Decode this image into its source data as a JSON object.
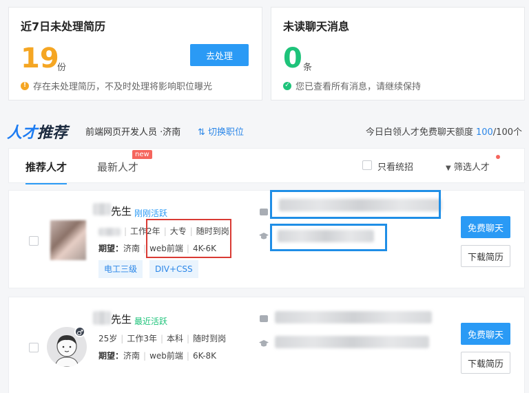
{
  "stats": {
    "pending": {
      "title": "近7日未处理简历",
      "count": "19",
      "unit": "份",
      "action": "去处理",
      "note": "存在未处理简历，不及时处理将影响职位曝光",
      "warn_icon": "!",
      "color": "#f5a623"
    },
    "unread": {
      "title": "未读聊天消息",
      "count": "0",
      "unit": "条",
      "note": "您已查看所有消息，请继续保持",
      "ok_icon": "✓",
      "color": "#1ec37a"
    }
  },
  "recommend": {
    "logo_a": "人才",
    "logo_b": "推荐",
    "position": "前端网页开发人员 ·济南",
    "switch_icon": "⇅",
    "switch_label": "切换职位",
    "quota_prefix": "今日白领人才免费聊天额度 ",
    "quota_used": "100",
    "quota_total": "/100个"
  },
  "tabs": {
    "recommended": "推荐人才",
    "latest": "最新人才",
    "new_badge": "new",
    "only_graduates": "只看统招",
    "filter_icon": "▼",
    "filter": "筛选人才"
  },
  "candidates": [
    {
      "name": "先生",
      "status": "刚刚活跃",
      "status_color": "#2a9af5",
      "exp": "工作2年",
      "edu": "大专",
      "avail": "随时到岗",
      "expect_label": "期望：",
      "city": "济南",
      "job": "web前端",
      "salary": "4K-6K",
      "tags": [
        "电工三级",
        "DIV+CSS"
      ],
      "chat": "免费聊天",
      "download": "下载简历"
    },
    {
      "name": "先生",
      "status": "最近活跃",
      "status_color": "#1ec37a",
      "age": "25岁",
      "exp": "工作3年",
      "edu": "本科",
      "avail": "随时到岗",
      "expect_label": "期望：",
      "city": "济南",
      "job": "web前端",
      "salary": "6K-8K",
      "gender_icon": "♂",
      "chat": "免费聊天",
      "download": "下载简历"
    }
  ]
}
